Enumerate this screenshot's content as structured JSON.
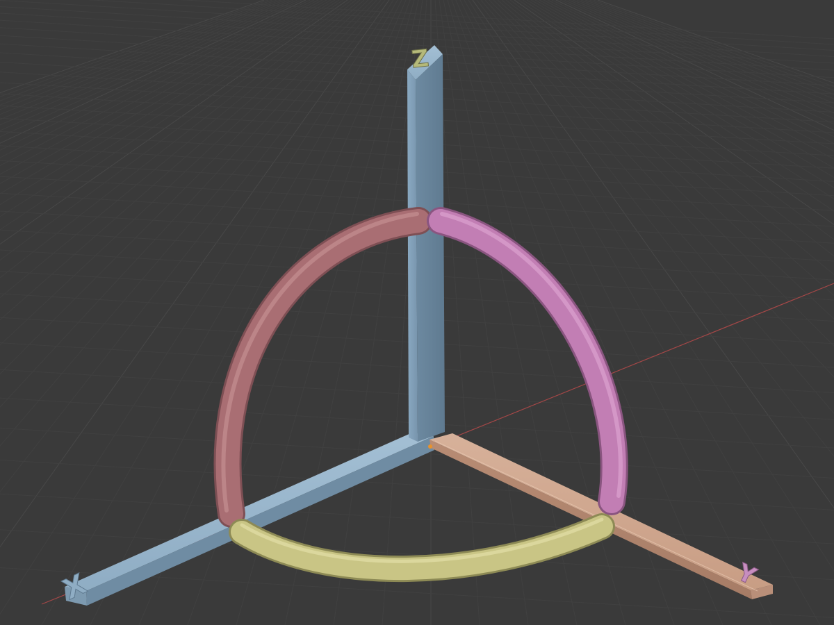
{
  "viewport": {
    "axis_labels": {
      "x": "X",
      "y": "Y",
      "z": "Z"
    },
    "colors": {
      "background": "#3a3a3a",
      "grid_minor": "#404040",
      "grid_major": "#484848",
      "x_axis_line": "#b84a4a",
      "blue_beam": "#7f9fb8",
      "peach_beam": "#c49a82",
      "arc_xz": "#a96e73",
      "arc_yz": "#c27eb4",
      "arc_xy": "#c9c585",
      "origin": "#e8922c"
    }
  }
}
